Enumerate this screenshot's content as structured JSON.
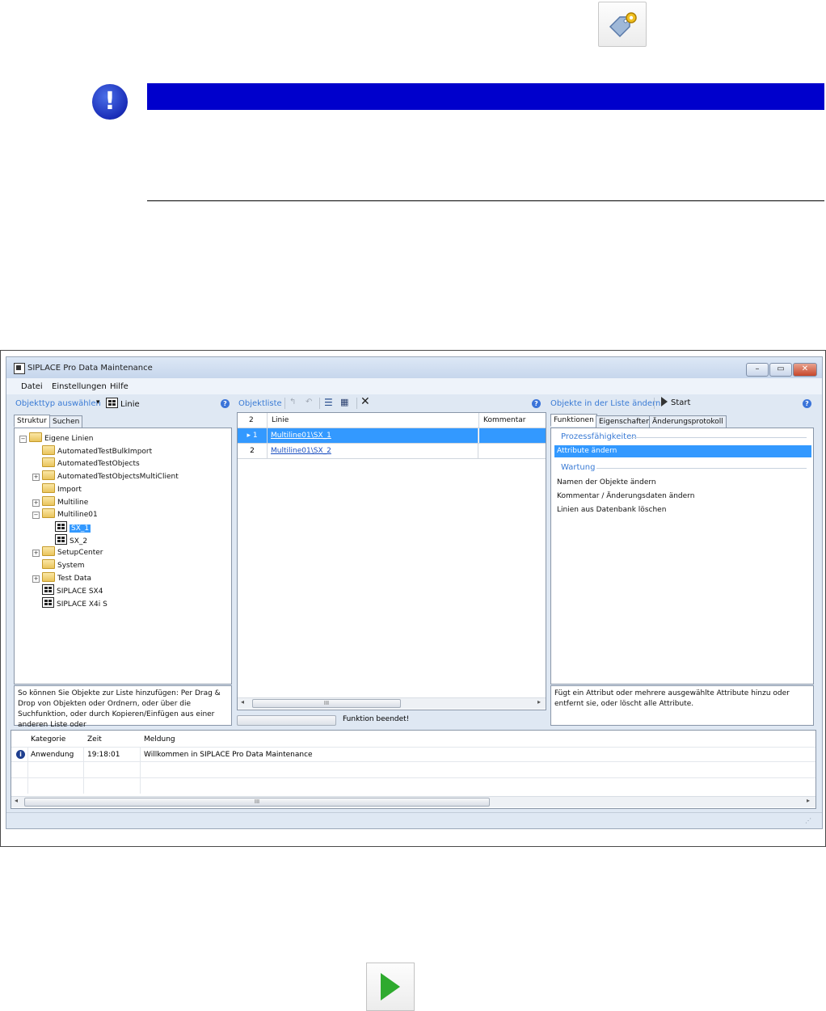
{
  "notice": {
    "icon": "exclamation-icon",
    "bar_color": "#0000cc"
  },
  "window": {
    "title": "SIPLACE Pro Data Maintenance",
    "controls": {
      "minimize": "–",
      "maximize": "▭",
      "close": "✕"
    }
  },
  "menu": [
    "Datei",
    "Einstellungen",
    "Hilfe"
  ],
  "left_panel": {
    "select_type": "Objekttyp auswählen",
    "dropdown_arrow": "▾",
    "type_value": "Linie",
    "tabs": [
      "Struktur",
      "Suchen"
    ],
    "tree": [
      {
        "label": "Eigene Linien",
        "level": 0,
        "kind": "folder",
        "expander": "−"
      },
      {
        "label": "AutomatedTestBulkImport",
        "level": 1,
        "kind": "folder",
        "expander": ""
      },
      {
        "label": "AutomatedTestObjects",
        "level": 1,
        "kind": "folder",
        "expander": ""
      },
      {
        "label": "AutomatedTestObjectsMultiClient",
        "level": 1,
        "kind": "folder",
        "expander": "+"
      },
      {
        "label": "Import",
        "level": 1,
        "kind": "folder",
        "expander": ""
      },
      {
        "label": "Multiline",
        "level": 1,
        "kind": "folder",
        "expander": "+"
      },
      {
        "label": "Multiline01",
        "level": 1,
        "kind": "folder",
        "expander": "−"
      },
      {
        "label": "SX_1",
        "level": 2,
        "kind": "line",
        "expander": "",
        "selected": true
      },
      {
        "label": "SX_2",
        "level": 2,
        "kind": "line",
        "expander": ""
      },
      {
        "label": "SetupCenter",
        "level": 1,
        "kind": "folder",
        "expander": "+"
      },
      {
        "label": "System",
        "level": 1,
        "kind": "folder",
        "expander": ""
      },
      {
        "label": "Test Data",
        "level": 1,
        "kind": "folder",
        "expander": "+"
      },
      {
        "label": "SIPLACE SX4",
        "level": 1,
        "kind": "line",
        "expander": ""
      },
      {
        "label": "SIPLACE X4i S",
        "level": 1,
        "kind": "line",
        "expander": ""
      }
    ],
    "hint": "So können Sie Objekte zur Liste hinzufügen: Per Drag & Drop von Objekten oder Ordnern, oder über die Suchfunktion, oder durch Kopieren/Einfügen aus einer anderen Liste oder"
  },
  "middle_panel": {
    "title": "Objektliste",
    "columns": {
      "count": "2",
      "line": "Linie",
      "comment": "Kommentar"
    },
    "rows": [
      {
        "num": "1",
        "line": "Multiline01\\SX_1",
        "comment": "",
        "selected": true
      },
      {
        "num": "2",
        "line": "Multiline01\\SX_2",
        "comment": ""
      }
    ],
    "scroll_grip": "III",
    "status": "Funktion beendet!"
  },
  "right_panel": {
    "title": "Objekte in der Liste ändern",
    "start_label": "Start",
    "tabs": [
      "Funktionen",
      "Eigenschaften",
      "Änderungsprotokoll"
    ],
    "section1": "Prozessfähigkeiten",
    "section1_items": [
      "Attribute ändern"
    ],
    "section2": "Wartung",
    "section2_items": [
      "Namen der Objekte ändern",
      "Kommentar / Änderungsdaten ändern",
      "Linien aus Datenbank löschen"
    ],
    "description": "Fügt ein Attribut oder mehrere ausgewählte Attribute hinzu oder entfernt sie, oder löscht alle Attribute."
  },
  "log": {
    "columns": [
      "Kategorie",
      "Zeit",
      "Meldung"
    ],
    "rows": [
      {
        "category": "Anwendung",
        "time": "19:18:01",
        "message": "Willkommen in SIPLACE Pro Data Maintenance"
      }
    ],
    "scroll_grip": "III"
  },
  "colors": {
    "selection": "#3399ff",
    "accent_text": "#3a7bd5",
    "play_green": "#2eaa2e"
  }
}
